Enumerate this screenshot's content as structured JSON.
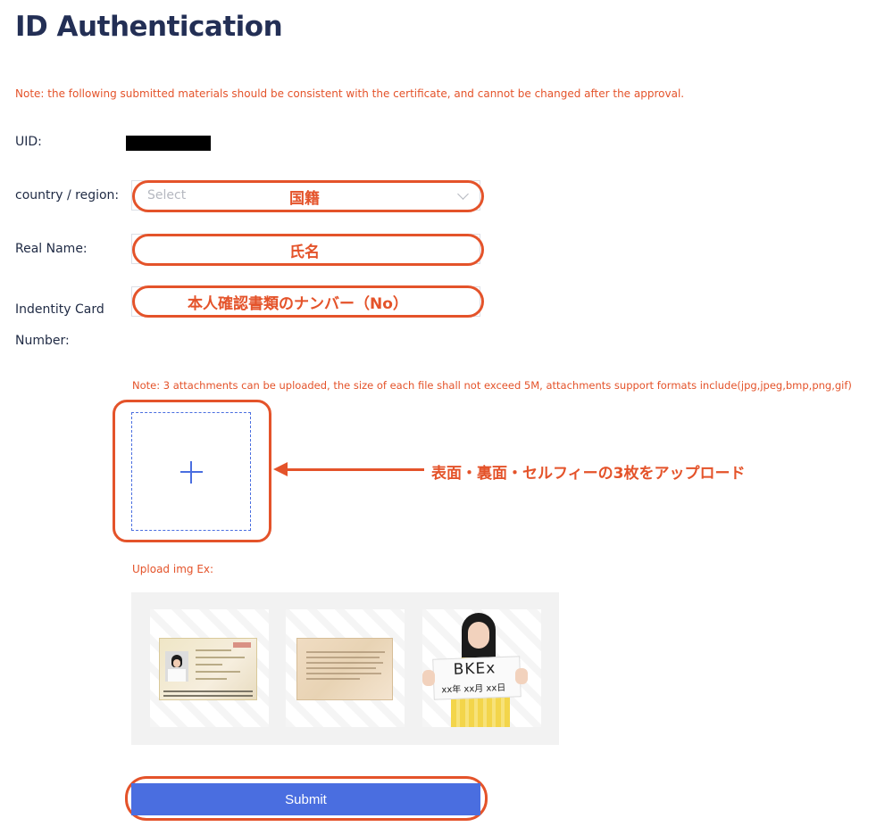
{
  "page": {
    "title": "ID Authentication"
  },
  "notes": {
    "top": "Note: the following submitted materials should be consistent with the certificate, and cannot be changed after the approval.",
    "attachments": "Note: 3 attachments can be uploaded, the size of each file shall not exceed 5M, attachments support formats include(jpg,jpeg,bmp,png,gif)",
    "upload_example_label": "Upload img Ex:"
  },
  "form": {
    "uid_label": "UID:",
    "country_label": "country / region:",
    "country_placeholder": "Select",
    "real_name_label": "Real Name:",
    "id_number_label": "Indentity Card Number:"
  },
  "annotations": {
    "country": "国籍",
    "name": "氏名",
    "id_number": "本人確認書類のナンバー（No）",
    "upload": "表面・裏面・セルフィーの3枚をアップロード"
  },
  "example_sign": {
    "line1": "BKEx",
    "line2": "xx年 xx月 xx日"
  },
  "submit_label": "Submit",
  "colors": {
    "accent": "#e4532a",
    "primary": "#4a6ee0",
    "title": "#232f55"
  },
  "icons": {
    "upload": "plus-icon",
    "select": "chevron-down-icon"
  }
}
